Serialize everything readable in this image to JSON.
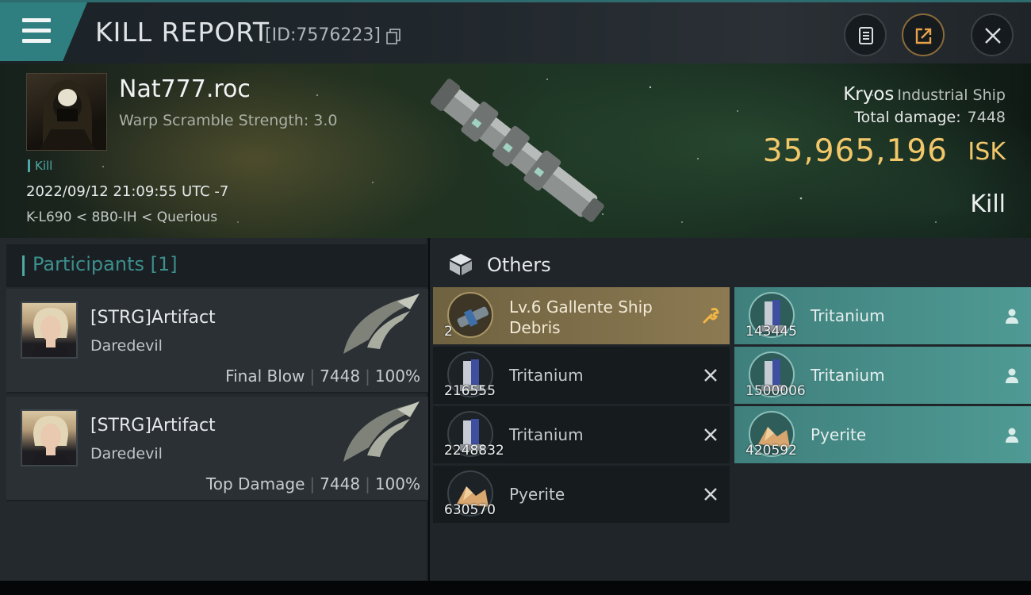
{
  "header": {
    "title": "KILL REPORT",
    "id_text": "[ID:7576223]",
    "icons": [
      "menu-icon",
      "copy-icon",
      "clipboard-icon",
      "share-icon",
      "close-icon"
    ]
  },
  "victim": {
    "name": "Nat777.roc",
    "warp_scramble": "Warp Scramble Strength: 3.0",
    "tag": "Kill",
    "datetime": "2022/09/12 21:09:55 UTC -7",
    "location": "K-L690 < 8B0-IH < Querious"
  },
  "ship": {
    "name": "Kryos",
    "class": "Industrial Ship",
    "total_damage_label": "Total damage:",
    "total_damage": "7448",
    "isk_value": "35,965,196",
    "isk_unit": "ISK",
    "result": "Kill"
  },
  "participants": {
    "header": "Participants [1]",
    "rows": [
      {
        "name": "[STRG]Artifact",
        "ship": "Daredevil",
        "role": "Final Blow",
        "damage": "7448",
        "percent": "100%"
      },
      {
        "name": "[STRG]Artifact",
        "ship": "Daredevil",
        "role": "Top Damage",
        "damage": "7448",
        "percent": "100%"
      }
    ]
  },
  "others": {
    "title": "Others",
    "left_items": [
      {
        "qty": "2",
        "name_line1": "Lv.6 Gallente Ship",
        "name_line2": "Debris",
        "status": "wrench-icon",
        "style": "gold"
      },
      {
        "qty": "216555",
        "name": "Tritanium",
        "status": "close-icon",
        "style": "dark"
      },
      {
        "qty": "2248832",
        "name": "Tritanium",
        "status": "close-icon",
        "style": "dark"
      },
      {
        "qty": "630570",
        "name": "Pyerite",
        "status": "close-icon",
        "style": "dark"
      }
    ],
    "right_items": [
      {
        "qty": "143445",
        "name": "Tritanium",
        "status": "person-icon",
        "style": "teal"
      },
      {
        "qty": "1500006",
        "name": "Tritanium",
        "status": "person-icon",
        "style": "teal"
      },
      {
        "qty": "420592",
        "name": "Pyerite",
        "status": "person-icon",
        "style": "teal"
      }
    ]
  },
  "colors": {
    "accent_teal": "#4fa8a5",
    "isk_gold": "#f2c76a",
    "dropped_gold": "#8c7a52",
    "dropped_teal": "#4f9a94"
  }
}
